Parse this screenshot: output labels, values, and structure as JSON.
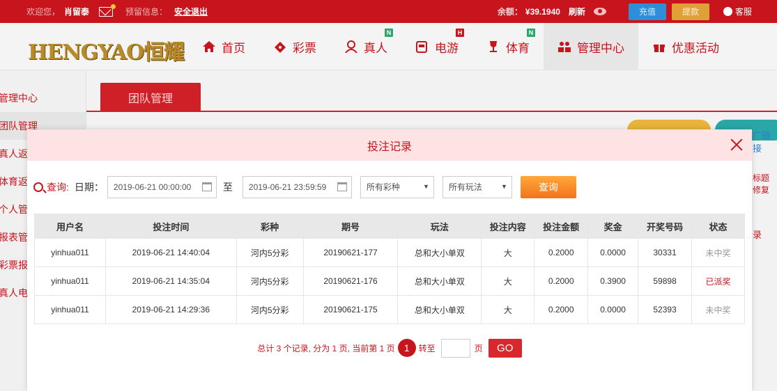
{
  "topbar": {
    "welcome": "欢迎您，",
    "username": "肖留泰",
    "warning_label": "预留信息：",
    "logout": "安全退出",
    "balance_label": "余额：",
    "balance_value": "¥39.1940",
    "refresh": "刷新",
    "recharge": "充值",
    "withdraw": "提款",
    "service": "客服"
  },
  "header": {
    "logo": "HENGYAO恒耀",
    "nav": [
      {
        "label": "首页",
        "icon": "home-icon"
      },
      {
        "label": "彩票",
        "icon": "ticket-icon"
      },
      {
        "label": "真人",
        "icon": "dealer-icon",
        "badge": "N"
      },
      {
        "label": "电游",
        "icon": "slot-icon",
        "badge": "H"
      },
      {
        "label": "体育",
        "icon": "trophy-icon",
        "badge": "N"
      },
      {
        "label": "管理中心",
        "icon": "users-icon"
      },
      {
        "label": "优惠活动",
        "icon": "gift-icon"
      }
    ]
  },
  "sidebar": {
    "items": [
      "管理中心",
      "团队管理",
      "真人返",
      "体育返",
      "个人管",
      "报表管",
      "彩票报",
      "真人电"
    ]
  },
  "content": {
    "tab": "团队管理",
    "link_text": "广链接",
    "side_text_1": "标题修复",
    "side_text_2": "录"
  },
  "modal": {
    "title": "投注记录",
    "query_label": "查询:",
    "date_label": "日期：",
    "date_from": "2019-06-21 00:00:00",
    "to_label": "至",
    "date_to": "2019-06-21 23:59:59",
    "lottery_select": "所有彩种",
    "play_select": "所有玩法",
    "query_button": "查询",
    "columns": [
      "用户名",
      "投注时间",
      "彩种",
      "期号",
      "玩法",
      "投注内容",
      "投注金额",
      "奖金",
      "开奖号码",
      "状态"
    ],
    "rows": [
      {
        "user": "yinhua011",
        "time": "2019-06-21 14:40:04",
        "lottery": "河内5分彩",
        "issue": "20190621-177",
        "play": "总和大小单双",
        "content": "大",
        "amount": "0.2000",
        "prize": "0.0000",
        "code": "30331",
        "status": "未中奖",
        "status_type": "lose"
      },
      {
        "user": "yinhua011",
        "time": "2019-06-21 14:35:04",
        "lottery": "河内5分彩",
        "issue": "20190621-176",
        "play": "总和大小单双",
        "content": "大",
        "amount": "0.2000",
        "prize": "0.3900",
        "code": "59898",
        "status": "已派奖",
        "status_type": "paid"
      },
      {
        "user": "yinhua011",
        "time": "2019-06-21 14:29:36",
        "lottery": "河内5分彩",
        "issue": "20190621-175",
        "play": "总和大小单双",
        "content": "大",
        "amount": "0.2000",
        "prize": "0.0000",
        "code": "52393",
        "status": "未中奖",
        "status_type": "lose"
      }
    ],
    "pager": {
      "summary": "总计 3 个记录, 分为 1 页, 当前第 1 页",
      "current": "1",
      "goto_label": "转至",
      "page_label": "页",
      "go_button": "GO"
    }
  },
  "colors": {
    "brand_red": "#c8141c",
    "modal_head": "#fde3e3",
    "query_orange": "#f2731c",
    "recharge_blue": "#2d8fd8",
    "withdraw_gold": "#e0a038"
  }
}
